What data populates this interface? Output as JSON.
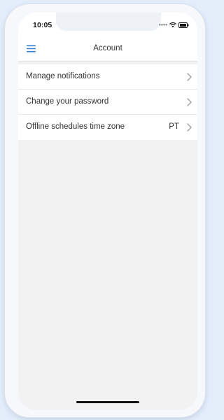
{
  "status_bar": {
    "time": "10:05",
    "signal_icon": "cellular-signal-icon",
    "wifi_icon": "wifi-icon",
    "battery_icon": "battery-icon"
  },
  "header": {
    "menu_icon": "hamburger-menu-icon",
    "title": "Account"
  },
  "settings": {
    "items": [
      {
        "label": "Manage notifications",
        "value": "",
        "icon": "chevron-right-icon"
      },
      {
        "label": "Change your password",
        "value": "",
        "icon": "chevron-right-icon"
      },
      {
        "label": "Offline schedules time zone",
        "value": "PT",
        "icon": "chevron-right-icon"
      }
    ]
  },
  "colors": {
    "accent": "#2f7fd6",
    "page_background": "#f2f2f2",
    "frame_background": "#e4eefb"
  }
}
